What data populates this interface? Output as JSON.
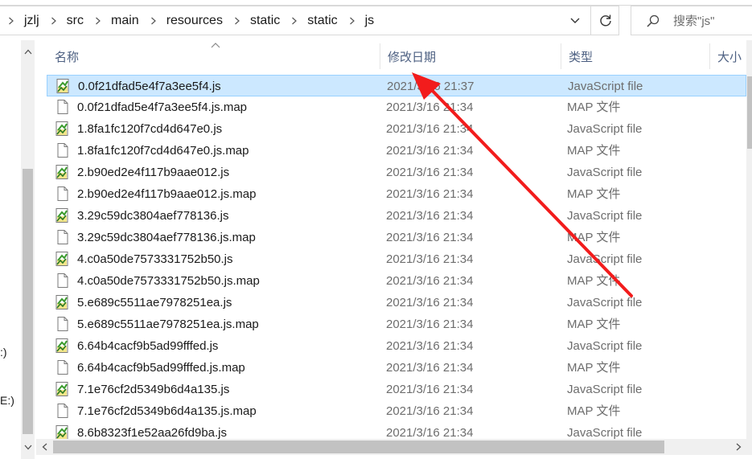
{
  "breadcrumb": [
    "jzlj",
    "src",
    "main",
    "resources",
    "static",
    "static",
    "js"
  ],
  "search": {
    "placeholder": "搜索\"js\""
  },
  "columns": {
    "name": "名称",
    "date": "修改日期",
    "type": "类型",
    "size": "大小"
  },
  "nav": {
    "drive1": ":)",
    "drive2": "E:)"
  },
  "files": [
    {
      "name": "0.0f21dfad5e4f7a3ee5f4.js",
      "date": "2021/3/16 21:37",
      "type": "JavaScript file",
      "kind": "js",
      "selected": true
    },
    {
      "name": "0.0f21dfad5e4f7a3ee5f4.js.map",
      "date": "2021/3/16 21:34",
      "type": "MAP 文件",
      "kind": "map"
    },
    {
      "name": "1.8fa1fc120f7cd4d647e0.js",
      "date": "2021/3/16 21:34",
      "type": "JavaScript file",
      "kind": "js"
    },
    {
      "name": "1.8fa1fc120f7cd4d647e0.js.map",
      "date": "2021/3/16 21:34",
      "type": "MAP 文件",
      "kind": "map"
    },
    {
      "name": "2.b90ed2e4f117b9aae012.js",
      "date": "2021/3/16 21:34",
      "type": "JavaScript file",
      "kind": "js"
    },
    {
      "name": "2.b90ed2e4f117b9aae012.js.map",
      "date": "2021/3/16 21:34",
      "type": "MAP 文件",
      "kind": "map"
    },
    {
      "name": "3.29c59dc3804aef778136.js",
      "date": "2021/3/16 21:34",
      "type": "JavaScript file",
      "kind": "js"
    },
    {
      "name": "3.29c59dc3804aef778136.js.map",
      "date": "2021/3/16 21:34",
      "type": "MAP 文件",
      "kind": "map"
    },
    {
      "name": "4.c0a50de7573331752b50.js",
      "date": "2021/3/16 21:34",
      "type": "JavaScript file",
      "kind": "js"
    },
    {
      "name": "4.c0a50de7573331752b50.js.map",
      "date": "2021/3/16 21:34",
      "type": "MAP 文件",
      "kind": "map"
    },
    {
      "name": "5.e689c5511ae7978251ea.js",
      "date": "2021/3/16 21:34",
      "type": "JavaScript file",
      "kind": "js"
    },
    {
      "name": "5.e689c5511ae7978251ea.js.map",
      "date": "2021/3/16 21:34",
      "type": "MAP 文件",
      "kind": "map"
    },
    {
      "name": "6.64b4cacf9b5ad99fffed.js",
      "date": "2021/3/16 21:34",
      "type": "JavaScript file",
      "kind": "js"
    },
    {
      "name": "6.64b4cacf9b5ad99fffed.js.map",
      "date": "2021/3/16 21:34",
      "type": "MAP 文件",
      "kind": "map"
    },
    {
      "name": "7.1e76cf2d5349b6d4a135.js",
      "date": "2021/3/16 21:34",
      "type": "JavaScript file",
      "kind": "js"
    },
    {
      "name": "7.1e76cf2d5349b6d4a135.js.map",
      "date": "2021/3/16 21:34",
      "type": "MAP 文件",
      "kind": "map"
    },
    {
      "name": "8.6b8323f1e52aa26fd9ba.js",
      "date": "2021/3/16 21:34",
      "type": "JavaScript file",
      "kind": "js"
    }
  ],
  "colors": {
    "selected_bg": "#cce8ff",
    "selected_border": "#99d1ff",
    "header_text": "#4d6082",
    "annotation_arrow": "#f21c1c"
  },
  "icons": {
    "js": "javascript-file-icon",
    "map": "blank-file-icon",
    "refresh": "refresh-icon",
    "search": "search-icon",
    "dropdown": "chevron-down-icon"
  }
}
